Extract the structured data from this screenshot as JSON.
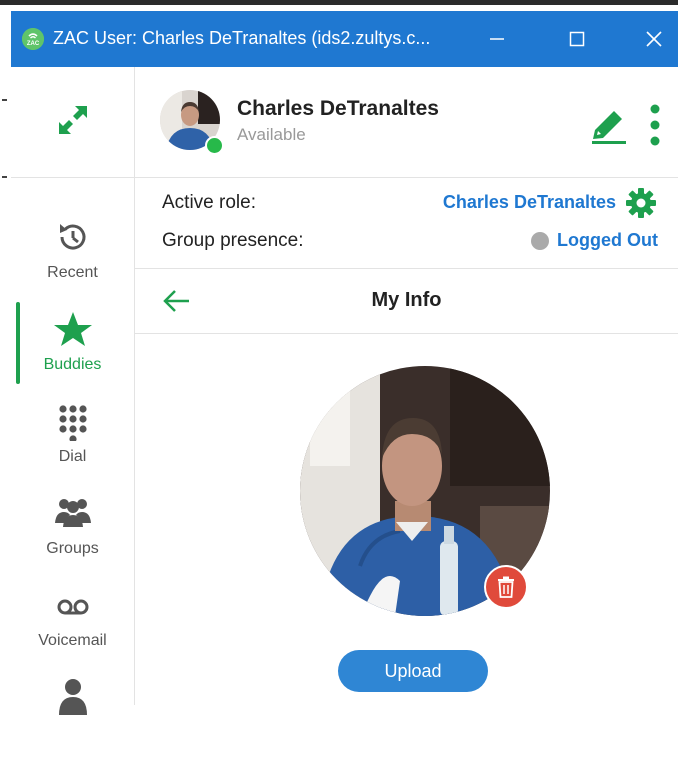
{
  "window": {
    "title": "ZAC User: Charles DeTranaltes (ids2.zultys.c...",
    "controls": {
      "minimize": "minimize",
      "maximize": "maximize",
      "close": "close"
    }
  },
  "colors": {
    "titlebar": "#1f78d1",
    "accent_green": "#1ea04e",
    "link_blue": "#1f78d1",
    "delete_red": "#e04a3b",
    "upload_blue": "#2f86d4"
  },
  "nav": {
    "expand_icon": "expand-arrows-icon",
    "items": [
      {
        "label": "Recent",
        "icon": "history-clock-icon",
        "active": false
      },
      {
        "label": "Buddies",
        "icon": "star-icon",
        "active": true
      },
      {
        "label": "Dial",
        "icon": "dialpad-icon",
        "active": false
      },
      {
        "label": "Groups",
        "icon": "group-icon",
        "active": false
      },
      {
        "label": "Voicemail",
        "icon": "voicemail-icon",
        "active": false
      },
      {
        "label": "",
        "icon": "person-icon",
        "active": false
      }
    ]
  },
  "profile": {
    "name": "Charles DeTranaltes",
    "status": "Available"
  },
  "roles": {
    "active_role_label": "Active role:",
    "active_role_value": "Charles DeTranaltes",
    "group_presence_label": "Group presence:",
    "group_presence_value": "Logged Out"
  },
  "section": {
    "title": "My Info"
  },
  "actions": {
    "upload_label": "Upload"
  }
}
